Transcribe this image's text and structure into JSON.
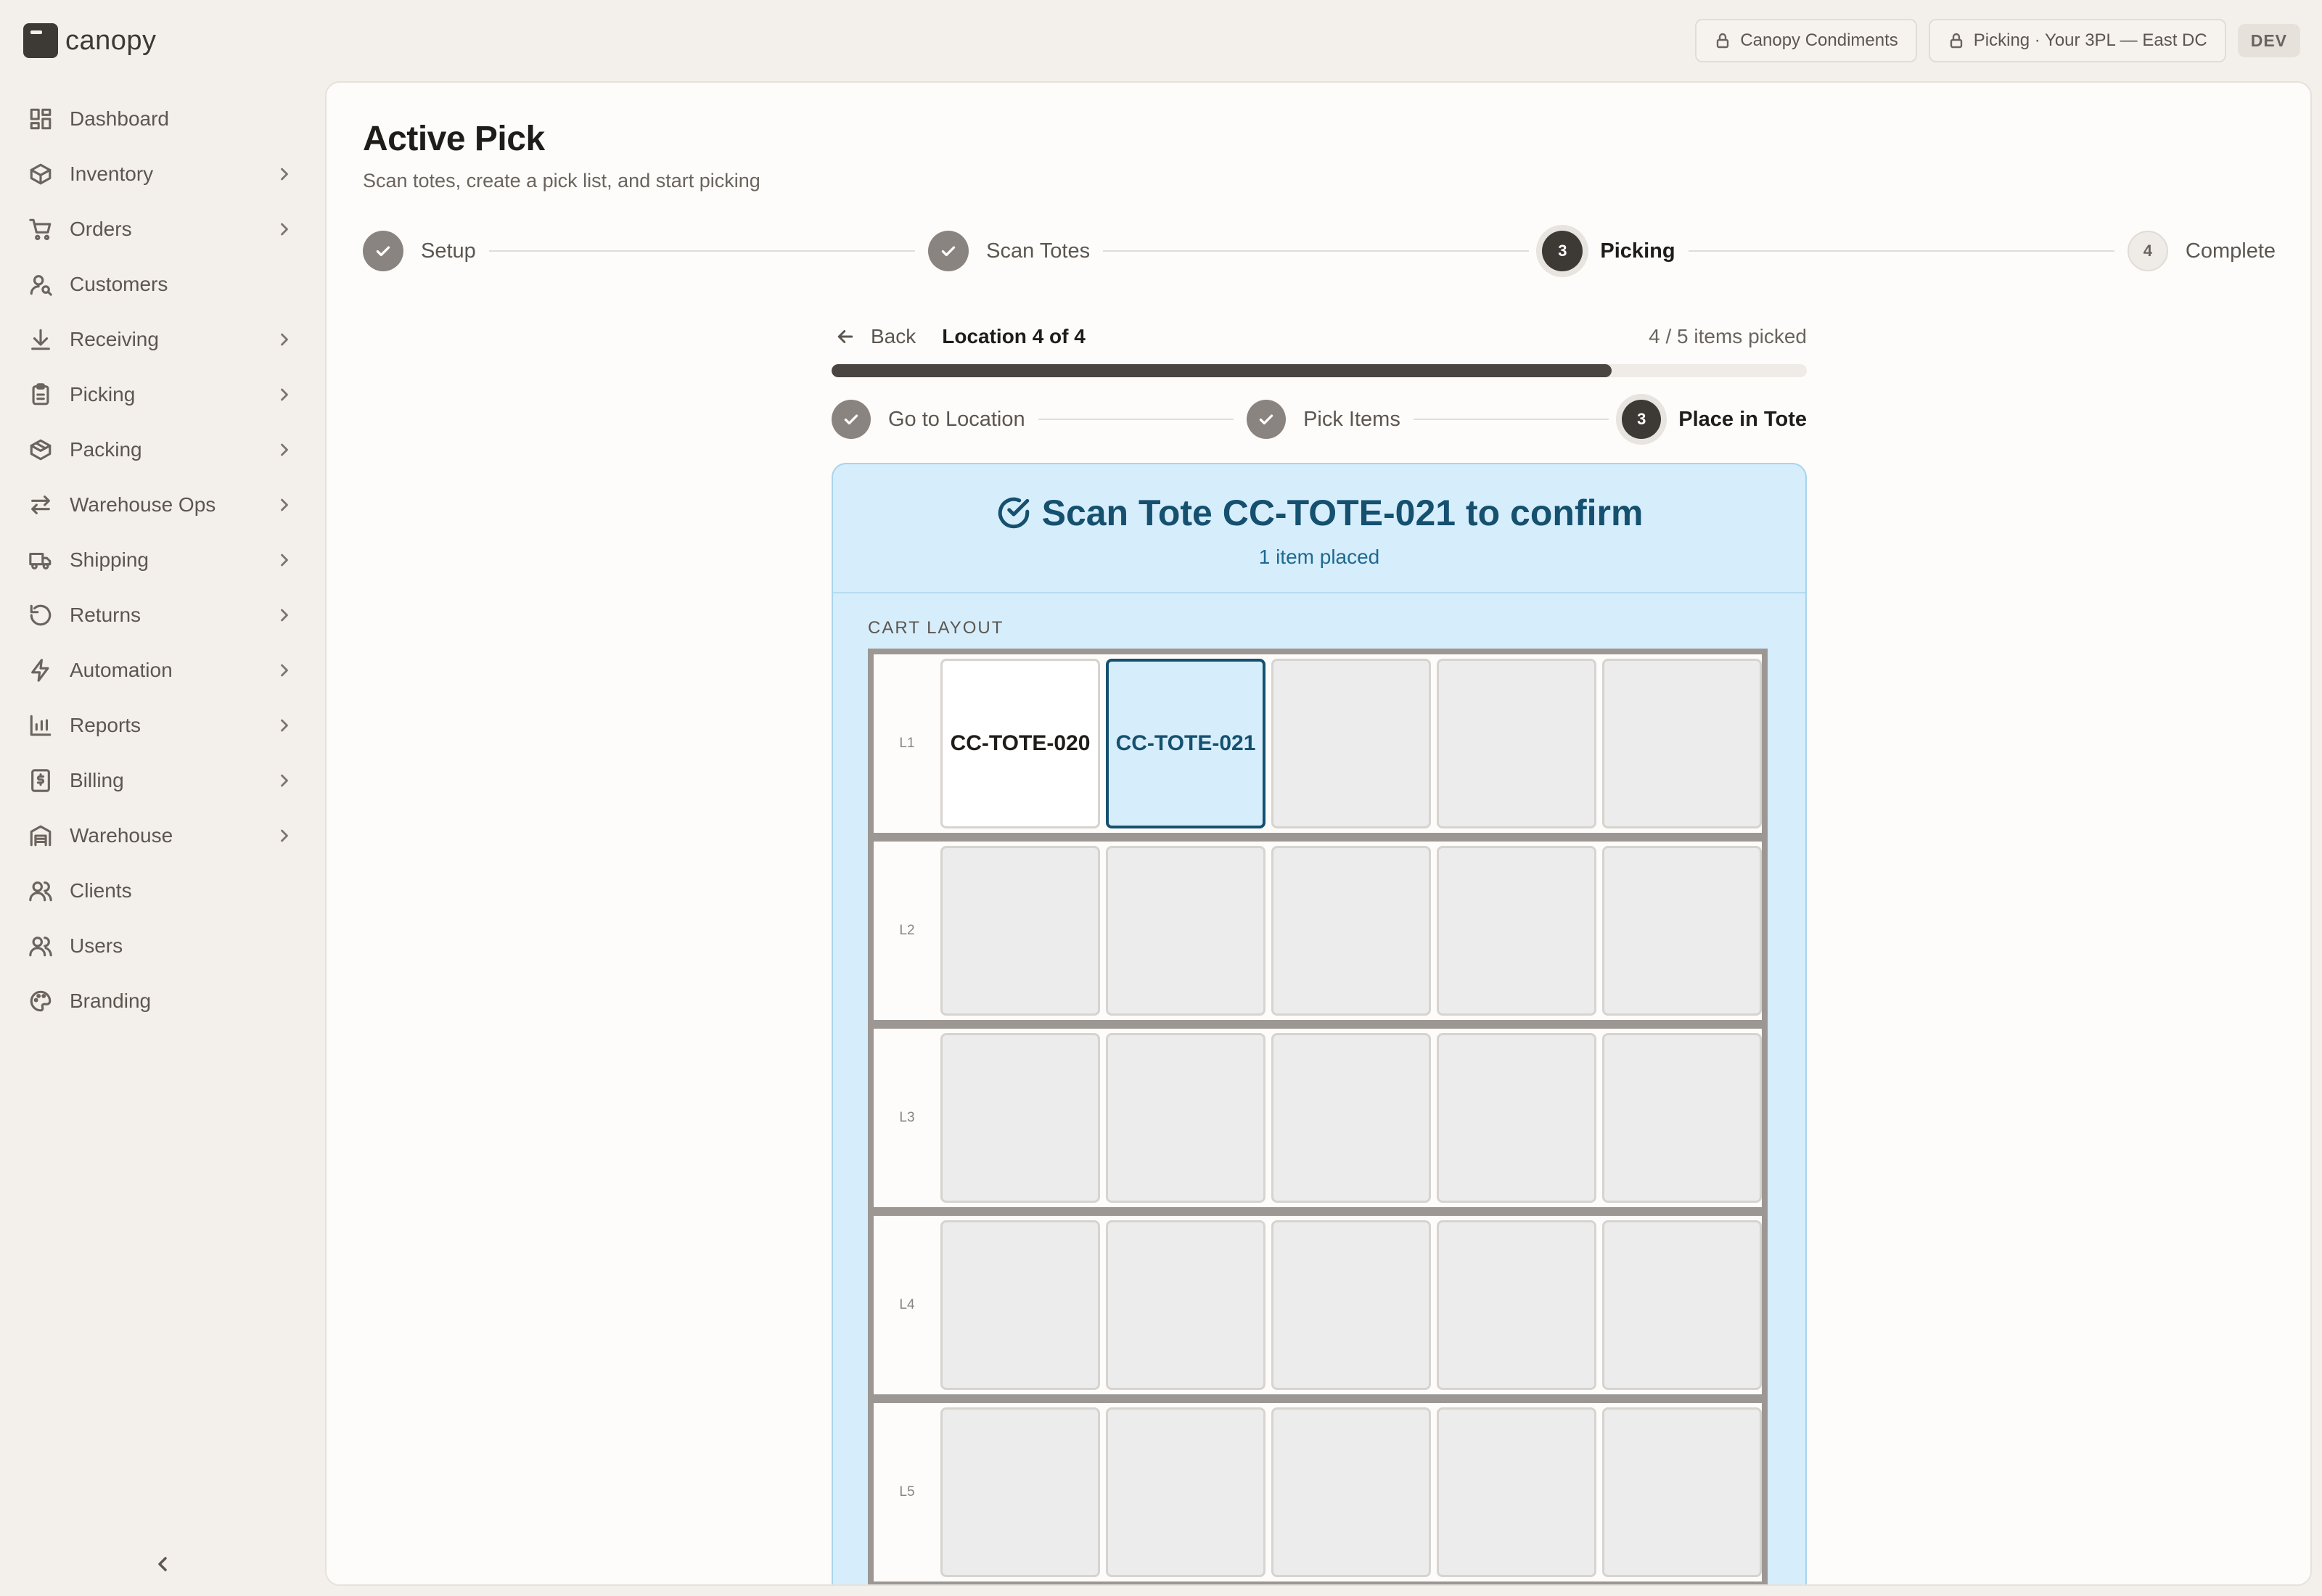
{
  "app": {
    "name": "canopy"
  },
  "sidebar": {
    "items": [
      {
        "label": "Dashboard",
        "icon": "dashboard-icon",
        "chevron": false
      },
      {
        "label": "Inventory",
        "icon": "box-icon",
        "chevron": true
      },
      {
        "label": "Orders",
        "icon": "cart-icon",
        "chevron": true
      },
      {
        "label": "Customers",
        "icon": "customer-icon",
        "chevron": false
      },
      {
        "label": "Receiving",
        "icon": "download-icon",
        "chevron": true
      },
      {
        "label": "Picking",
        "icon": "clipboard-icon",
        "chevron": true
      },
      {
        "label": "Packing",
        "icon": "package-icon",
        "chevron": true
      },
      {
        "label": "Warehouse Ops",
        "icon": "arrows-icon",
        "chevron": true
      },
      {
        "label": "Shipping",
        "icon": "truck-icon",
        "chevron": true
      },
      {
        "label": "Returns",
        "icon": "return-icon",
        "chevron": true
      },
      {
        "label": "Automation",
        "icon": "bolt-icon",
        "chevron": true
      },
      {
        "label": "Reports",
        "icon": "bar-chart-icon",
        "chevron": true
      },
      {
        "label": "Billing",
        "icon": "receipt-icon",
        "chevron": true
      },
      {
        "label": "Warehouse",
        "icon": "warehouse-icon",
        "chevron": true
      },
      {
        "label": "Clients",
        "icon": "users-icon",
        "chevron": false
      },
      {
        "label": "Users",
        "icon": "users-icon",
        "chevron": false
      },
      {
        "label": "Branding",
        "icon": "palette-icon",
        "chevron": false
      }
    ]
  },
  "topbar": {
    "client": "Canopy Condiments",
    "context": "Picking · Your 3PL — East DC",
    "env": "DEV"
  },
  "page": {
    "title": "Active Pick",
    "subtitle": "Scan totes, create a pick list, and start picking"
  },
  "stepper": [
    {
      "label": "Setup",
      "state": "done",
      "number": "1"
    },
    {
      "label": "Scan Totes",
      "state": "done",
      "number": "2"
    },
    {
      "label": "Picking",
      "state": "active",
      "number": "3"
    },
    {
      "label": "Complete",
      "state": "todo",
      "number": "4"
    }
  ],
  "pick": {
    "back_label": "Back",
    "location": "Location 4 of 4",
    "items_picked": "4 / 5 items picked",
    "progress": 0.8
  },
  "substeps": [
    {
      "label": "Go to Location",
      "state": "done",
      "number": "1"
    },
    {
      "label": "Pick Items",
      "state": "done",
      "number": "2"
    },
    {
      "label": "Place in Tote",
      "state": "active",
      "number": "3"
    }
  ],
  "scan": {
    "title": "Scan Tote CC-TOTE-021 to confirm",
    "subtitle": "1 item placed",
    "cart_label": "CART LAYOUT",
    "shelves": [
      {
        "label": "L1",
        "cells": [
          {
            "tote": "CC-TOTE-020",
            "state": "filled"
          },
          {
            "tote": "CC-TOTE-021",
            "state": "target"
          },
          {
            "tote": "",
            "state": "empty"
          },
          {
            "tote": "",
            "state": "empty"
          },
          {
            "tote": "",
            "state": "empty"
          }
        ]
      },
      {
        "label": "L2",
        "cells": [
          {
            "tote": "",
            "state": "empty"
          },
          {
            "tote": "",
            "state": "empty"
          },
          {
            "tote": "",
            "state": "empty"
          },
          {
            "tote": "",
            "state": "empty"
          },
          {
            "tote": "",
            "state": "empty"
          }
        ]
      },
      {
        "label": "L3",
        "cells": [
          {
            "tote": "",
            "state": "empty"
          },
          {
            "tote": "",
            "state": "empty"
          },
          {
            "tote": "",
            "state": "empty"
          },
          {
            "tote": "",
            "state": "empty"
          },
          {
            "tote": "",
            "state": "empty"
          }
        ]
      },
      {
        "label": "L4",
        "cells": [
          {
            "tote": "",
            "state": "empty"
          },
          {
            "tote": "",
            "state": "empty"
          },
          {
            "tote": "",
            "state": "empty"
          },
          {
            "tote": "",
            "state": "empty"
          },
          {
            "tote": "",
            "state": "empty"
          }
        ]
      },
      {
        "label": "L5",
        "cells": [
          {
            "tote": "",
            "state": "empty"
          },
          {
            "tote": "",
            "state": "empty"
          },
          {
            "tote": "",
            "state": "empty"
          },
          {
            "tote": "",
            "state": "empty"
          },
          {
            "tote": "",
            "state": "empty"
          }
        ]
      }
    ]
  },
  "colors": {
    "accent": "#15506f",
    "scan_bg": "#d6edfb",
    "sidebar_bg": "#f3efea",
    "card_bg": "#fdfcfa"
  }
}
